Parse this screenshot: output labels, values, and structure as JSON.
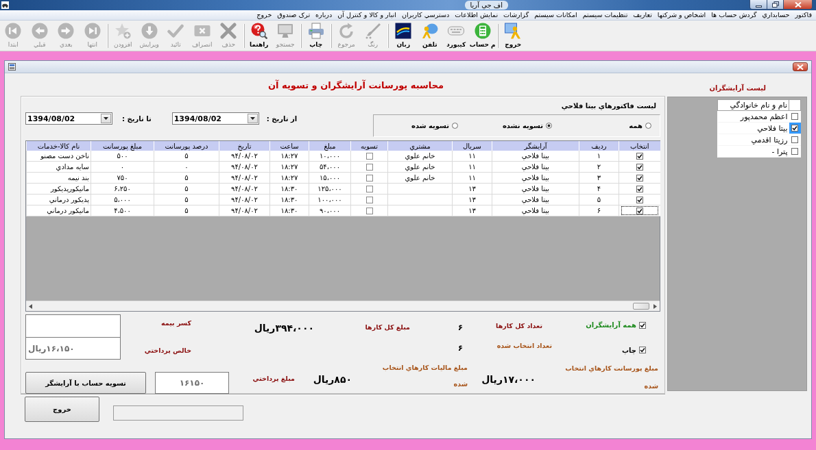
{
  "window": {
    "title": "اف جي آريا"
  },
  "menu": [
    "فاکتور",
    "حسابداري",
    "گردش حساب ها",
    "اشخاص و شرکتها",
    "تعاريف",
    "تنظيمات سيستم",
    "امکانات سيستم",
    "گزارشات",
    "نمايش اطلاعات",
    "دسترسي کاربران",
    "انبار و کالا و کنترل آن",
    "درباره",
    "ترک صندوق",
    "خروج"
  ],
  "toolbar": [
    [
      {
        "label": "خروج",
        "disabled": false
      }
    ],
    [
      {
        "label": "م حساب",
        "disabled": false
      },
      {
        "label": "کيبورد",
        "disabled": false
      },
      {
        "label": "تلفن",
        "disabled": false
      },
      {
        "label": "زبان",
        "disabled": false
      }
    ],
    [
      {
        "label": "رنگ",
        "disabled": true
      },
      {
        "label": "مرجوع",
        "disabled": true
      }
    ],
    [
      {
        "label": "چاپ",
        "disabled": false
      }
    ],
    [
      {
        "label": "جستجو",
        "disabled": true
      },
      {
        "label": "راهنما",
        "disabled": false
      }
    ],
    [
      {
        "label": "حذف",
        "disabled": true
      },
      {
        "label": "انصراف",
        "disabled": true
      },
      {
        "label": "تائيد",
        "disabled": true
      },
      {
        "label": "ويرايش",
        "disabled": true
      },
      {
        "label": "افزودن",
        "disabled": true
      }
    ],
    [
      {
        "label": "انتها",
        "disabled": true
      },
      {
        "label": "بعدي",
        "disabled": true
      },
      {
        "label": "قبلي",
        "disabled": true
      },
      {
        "label": "ابتدا",
        "disabled": true
      }
    ]
  ],
  "form": {
    "title": "محاسبه پورسانت آرايشگران و تسويه آن"
  },
  "stylists": {
    "title": "ليست آرايشگران",
    "column": "نام و نام خانوادگي",
    "items": [
      {
        "name": "اعظم محمدپور",
        "checked": false,
        "selected": false
      },
      {
        "name": "بيتا فلاحي",
        "checked": true,
        "selected": true
      },
      {
        "name": "رزيتا اقدمي",
        "checked": false,
        "selected": false
      },
      {
        "name": "پترا -",
        "checked": false,
        "selected": false
      }
    ]
  },
  "invoices": {
    "title": "ليست فاکتورهاي بيتا فلاحي",
    "filter": [
      {
        "label": "همه",
        "selected": false
      },
      {
        "label": "تسويه نشده",
        "selected": true
      },
      {
        "label": "تسويه شده",
        "selected": false
      }
    ],
    "from_label": "از تاريخ :",
    "from_date": "1394/08/02",
    "to_label": "تا تاريخ :",
    "to_date": "1394/08/02",
    "columns": [
      "انتخاب",
      "رديف",
      "آرايشگر",
      "سريال",
      "مشتري",
      "تسويه",
      "مبلغ",
      "ساعت",
      "تاريخ",
      "درصد پورسانت",
      "مبلغ پورسانت",
      "نام کالا-خدمات"
    ],
    "rows": [
      {
        "checked": true,
        "focused": false,
        "number": "۱",
        "stylist": "بيتا فلاحي",
        "serial": "۱۱",
        "customer": "خانم علوي",
        "settled": false,
        "amount": "۱۰،۰۰۰",
        "time": "۱۸:۲۷",
        "date": "۹۴/۰۸/۰۲",
        "percent": "۵",
        "commission": "۵۰۰",
        "item": "ناخن دست مصنو"
      },
      {
        "checked": true,
        "focused": false,
        "number": "۲",
        "stylist": "بيتا فلاحي",
        "serial": "۱۱",
        "customer": "خانم علوي",
        "settled": false,
        "amount": "۵۴،۰۰۰",
        "time": "۱۸:۲۷",
        "date": "۹۴/۰۸/۰۲",
        "percent": "۰",
        "commission": "۰",
        "item": "سايه مدادي"
      },
      {
        "checked": true,
        "focused": false,
        "number": "۳",
        "stylist": "بيتا فلاحي",
        "serial": "۱۱",
        "customer": "خانم علوي",
        "settled": false,
        "amount": "۱۵،۰۰۰",
        "time": "۱۸:۲۷",
        "date": "۹۴/۰۸/۰۲",
        "percent": "۵",
        "commission": "۷۵۰",
        "item": "بند نيمه"
      },
      {
        "checked": true,
        "focused": false,
        "number": "۴",
        "stylist": "بيتا فلاحي",
        "serial": "۱۳",
        "settled": false,
        "amount": "۱۲۵،۰۰۰",
        "time": "۱۸:۳۰",
        "date": "۹۴/۰۸/۰۲",
        "percent": "۵",
        "commission": "۶،۲۵۰",
        "item": "مانيکورپديکور"
      },
      {
        "checked": true,
        "focused": false,
        "number": "۵",
        "stylist": "بيتا فلاحي",
        "serial": "۱۳",
        "settled": false,
        "amount": "۱۰۰،۰۰۰",
        "time": "۱۸:۳۰",
        "date": "۹۴/۰۸/۰۲",
        "percent": "۵",
        "commission": "۵،۰۰۰",
        "item": "پديکور درماني"
      },
      {
        "checked": true,
        "focused": true,
        "number": "۶",
        "stylist": "بيتا فلاحي",
        "serial": "۱۳",
        "settled": false,
        "amount": "۹۰،۰۰۰",
        "time": "۱۸:۳۰",
        "date": "۹۴/۰۸/۰۲",
        "percent": "۵",
        "commission": "۴،۵۰۰",
        "item": "مانيکور درماني"
      }
    ]
  },
  "summary": {
    "all_stylists": {
      "label": "همه آرايشگران",
      "checked": true
    },
    "print": {
      "label": "چاپ",
      "checked": true
    },
    "total_count": {
      "label": "تعداد کل کارها",
      "value": "۶"
    },
    "selected_count": {
      "label": "تعداد انتخاب شده",
      "value": "۶"
    },
    "total_amount": {
      "label": "مبلغ کل کارها",
      "value": "۳۹۴،۰۰۰ريال"
    },
    "insurance": {
      "label": "کسر بيمه"
    },
    "net": {
      "label": "خالص پرداختي",
      "value": "۱۶،۱۵۰ريال",
      "disabled": true
    },
    "commission": {
      "label": "مبلغ پورسانت کارهاي انتخاب شده",
      "value": "۱۷،۰۰۰ريال"
    },
    "tax": {
      "label": "مبلغ ماليات کارهاي انتخاب شده",
      "value": "۸۵۰ريال"
    },
    "payment": {
      "label": "مبلغ پرداختي",
      "value": "۱۶۱۵۰",
      "disabled": true
    },
    "settle_button": "تسويه حساب با آرايشگر"
  },
  "exit_button": "خروج"
}
